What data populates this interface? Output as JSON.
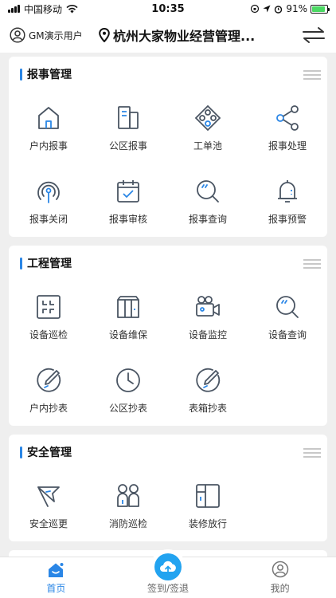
{
  "status": {
    "carrier": "中国移动",
    "time": "10:35",
    "battery": "91%",
    "battery_level": 0.91
  },
  "header": {
    "user_name": "GM演示用户",
    "location": "杭州大家物业经营管理..."
  },
  "sections": [
    {
      "title": "报事管理",
      "items": [
        {
          "label": "户内报事",
          "icon": "house-icon"
        },
        {
          "label": "公区报事",
          "icon": "building-icon"
        },
        {
          "label": "工单池",
          "icon": "network-diamond-icon"
        },
        {
          "label": "报事处理",
          "icon": "share-nodes-icon"
        },
        {
          "label": "报事关闭",
          "icon": "signal-beacon-icon"
        },
        {
          "label": "报事审核",
          "icon": "calendar-check-icon"
        },
        {
          "label": "报事查询",
          "icon": "magnifier-icon"
        },
        {
          "label": "报事预警",
          "icon": "bell-icon"
        }
      ]
    },
    {
      "title": "工程管理",
      "items": [
        {
          "label": "设备巡检",
          "icon": "scan-frame-icon"
        },
        {
          "label": "设备维保",
          "icon": "cabinet-icon"
        },
        {
          "label": "设备监控",
          "icon": "video-camera-icon"
        },
        {
          "label": "设备查询",
          "icon": "magnifier-icon"
        },
        {
          "label": "户内抄表",
          "icon": "pencil-circle-icon"
        },
        {
          "label": "公区抄表",
          "icon": "clock-icon"
        },
        {
          "label": "表箱抄表",
          "icon": "pencil-circle-icon"
        }
      ]
    },
    {
      "title": "安全管理",
      "items": [
        {
          "label": "安全巡更",
          "icon": "flag-icon"
        },
        {
          "label": "消防巡检",
          "icon": "people-icon"
        },
        {
          "label": "装修放行",
          "icon": "floor-plan-icon"
        }
      ]
    }
  ],
  "tabs": [
    {
      "label": "首页",
      "icon": "home-tab-icon",
      "active": true
    },
    {
      "label": "签到/签退",
      "icon": "cloud-upload-icon",
      "active": false
    },
    {
      "label": "我的",
      "icon": "person-icon",
      "active": false
    }
  ],
  "colors": {
    "accent": "#2a86e6",
    "icon_stroke": "#4a5563",
    "checkin_button": "#22a3f0"
  }
}
